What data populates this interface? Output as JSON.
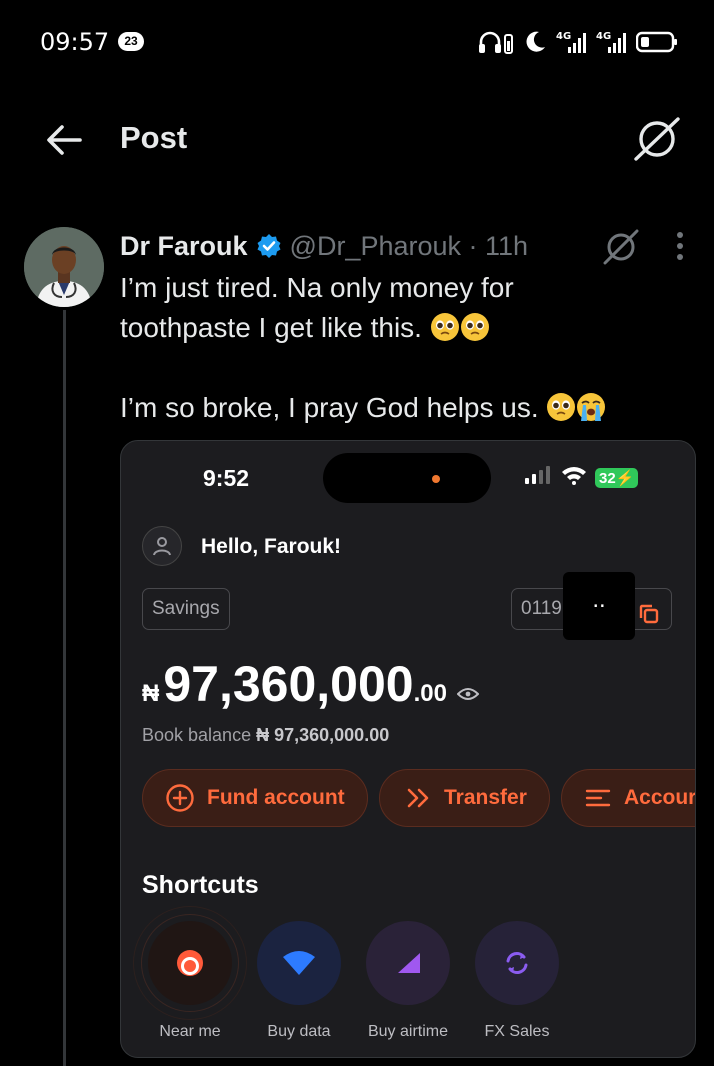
{
  "status_bar": {
    "time": "09:57",
    "notification_count": "23",
    "network_1": "4G",
    "network_2": "4G"
  },
  "header": {
    "title": "Post"
  },
  "tweet": {
    "author_name": "Dr Farouk",
    "handle_time": "@Dr_Pharouk · 11h",
    "lines": [
      "I’m just tired. Na only money for",
      "toothpaste I get like this.",
      "I’m so broke, I pray God helps us."
    ],
    "emojis": [
      "pleading-face",
      "pleading-face",
      "pleading-face",
      "loudly-crying-face"
    ]
  },
  "media": {
    "time": "9:52",
    "battery": "32",
    "greeting": "Hello, Farouk!",
    "account_type": "Savings",
    "account_number_partial": "0119",
    "redaction_text": "..",
    "currency_symbol": "₦",
    "balance_main": "97,360,000",
    "balance_cents": ".00",
    "book_balance_label": "Book balance",
    "book_balance_value": "₦ 97,360,000.00",
    "buttons": {
      "fund": "Fund account",
      "transfer": "Transfer",
      "accounts": "Accour"
    },
    "shortcuts_title": "Shortcuts",
    "shortcuts": [
      {
        "label": "Near me",
        "icon": "near-me-icon"
      },
      {
        "label": "Buy data",
        "icon": "wifi-icon"
      },
      {
        "label": "Buy airtime",
        "icon": "signal-triangle-icon"
      },
      {
        "label": "FX Sales",
        "icon": "exchange-icon"
      }
    ]
  },
  "colors": {
    "accent_orange": "#ff6b3d",
    "verified_blue": "#1d9bf0",
    "background": "#000000"
  }
}
